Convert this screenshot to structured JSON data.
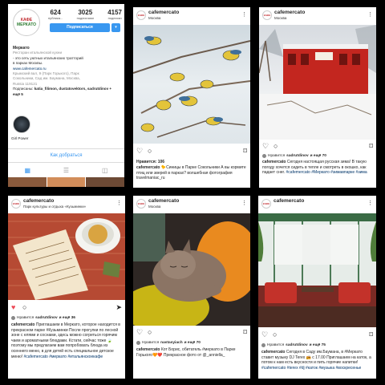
{
  "profile": {
    "logo_text": [
      "КАФЕ",
      "МЕРКАТО"
    ],
    "stats": [
      {
        "value": "624",
        "label": "публика..."
      },
      {
        "value": "3025",
        "label": "подписчики"
      },
      {
        "value": "4157",
        "label": "подписки"
      }
    ],
    "subscribe_label": "Подписаться",
    "subscribe_arrow": "▾",
    "name": "Меркато",
    "category": "Ресторан итальянской кухни",
    "bio_lines": [
      "- это сеть уютных итальянских тратторий",
      "в парках Москвы."
    ],
    "website": "www.cafemercato.ru",
    "address_lines": [
      "Крымский вал, 9 (Парк Горького), Парк",
      "Сокольники, Сад им. Баумана, Москва,",
      "Russia 119121"
    ],
    "followed_by_prefix": "Подписаны:",
    "followed_by": "katia_filimon, dustatovektors, sadrutdinov + ещё 5",
    "highlight_label": "Girl Power",
    "contact_label": "Как добраться",
    "tab_icons": [
      "grid-tab",
      "list-tab",
      "tagged-tab"
    ]
  },
  "posts": [
    {
      "account": "cafemercato",
      "location": "Москва",
      "likes": "Нравится: 106",
      "caption_user": "cafemercato",
      "caption": "🐤Синицы в Парке Сокольники А вы кормите птиц или зверей в парках? волшебная фотография travelmaniac_ru"
    },
    {
      "account": "cafemercato",
      "location": "Москва",
      "liked_by_prefix": "Нравится",
      "liked_by_user": "sadrutdinov",
      "liked_by_rest": "и ещё 70",
      "caption_user": "cafemercato",
      "caption": "Сегодня настоящая русская зима! В такую погоду хочется сидеть в тепле и смотреть в окошко, как падает снег.",
      "hashtags": "#cafemercato #Меркато #зимавпарке #зима"
    },
    {
      "account": "cafemercato",
      "location": "Парк культуры и отдыха «Кузьминки»",
      "liked_by_prefix": "Нравится",
      "liked_by_user": "sadrutdinov",
      "liked_by_rest": "и ещё 36",
      "caption_user": "cafemercato",
      "caption": "Приглашаем в Меркато, которое находится в прекрасном парке #Кузьминки После прогулки по лесной зоне с елями и соснами, здесь можно согреться горячим чаем и ароматными блюдами. Кстати, сейчас тоже 🍃 поэтому мы предлагаем вам попробовать блюда из осеннего меню, в для детей есть специальное детское меню!",
      "hashtags": "#cafemercato #меркато #итальянскоекафе"
    },
    {
      "account": "cafemercato",
      "location": "Москва",
      "liked_by_prefix": "Нравится",
      "liked_by_user": "nastasyiach",
      "liked_by_rest": "и ещё 70",
      "caption_user": "cafemercato",
      "caption": "Кот Борис, обитатель #меркато в Парке Горького🧡❤️ Прекрасное фото от @_anniella_"
    },
    {
      "account": "cafemercato",
      "location": "",
      "liked_by_prefix": "Нравится",
      "liked_by_user": "sadrutdinov",
      "liked_by_rest": "и ещё 75",
      "caption_user": "cafemercato",
      "caption": "Сегодня в Саду им.Баумана, в #Меркато ставит музыку DJ Terex 📻 с 17.00 Приглашаем на каток, а потом к нам есть вкусности и пить горячие напитки!",
      "hashtags": "#cafemercato #terex #dj #каток #музыка #воскресенье"
    }
  ],
  "icons": {
    "heart": "♡",
    "heart_filled": "♥",
    "comment": "○",
    "share": "➤",
    "save": "⌑",
    "more": "⋮"
  },
  "colors": {
    "accent": "#3897f0",
    "link": "#003569",
    "like_red": "#ed4956"
  }
}
